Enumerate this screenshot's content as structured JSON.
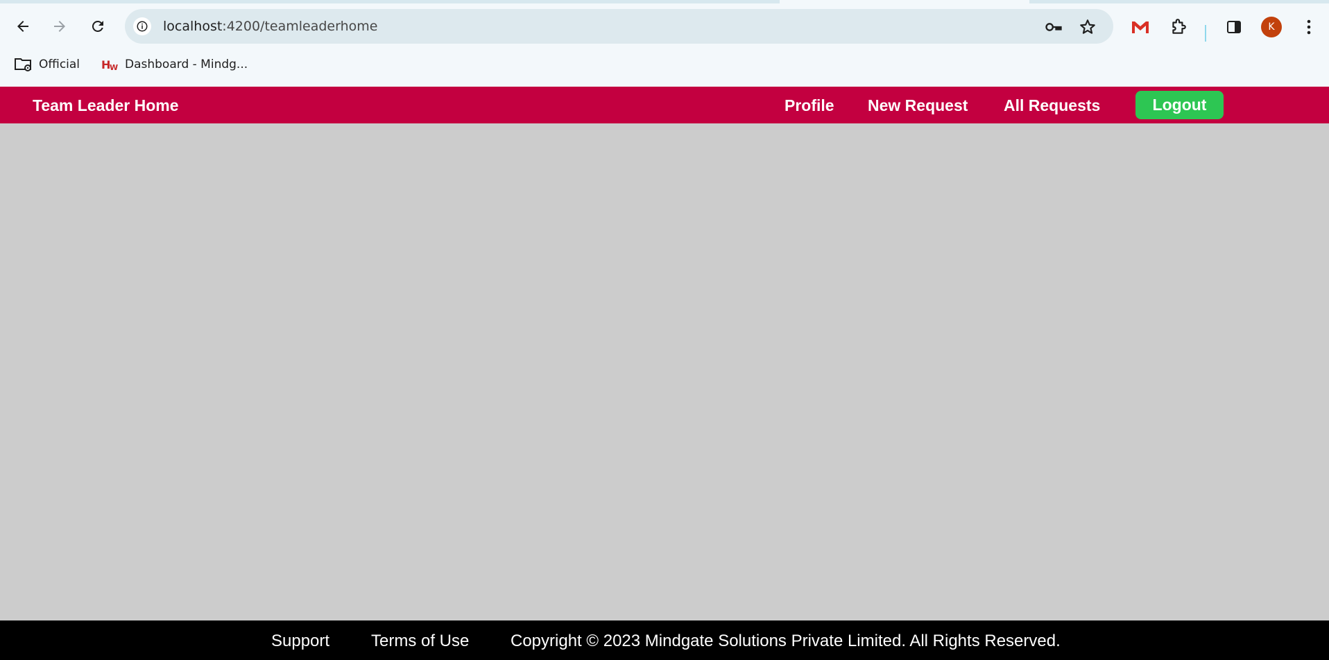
{
  "browser": {
    "url_host": "localhost",
    "url_path": ":4200/teamleaderhome",
    "bookmarks": [
      {
        "label": "Official",
        "icon": "folder-settings-icon"
      },
      {
        "label": "Dashboard - Mindg...",
        "icon": "hw-site-icon"
      }
    ],
    "profile_initial": "K",
    "colors": {
      "chrome_bg": "#f3f8fb",
      "omnibox_bg": "#dde9ee",
      "avatar": "#c2410c"
    }
  },
  "header": {
    "brand": "Team Leader Home",
    "nav": [
      {
        "label": "Profile"
      },
      {
        "label": "New Request"
      },
      {
        "label": "All Requests"
      }
    ],
    "logout_label": "Logout",
    "colors": {
      "bar": "#c30040",
      "logout": "#2dc653"
    }
  },
  "footer": {
    "support": "Support",
    "terms": "Terms of Use",
    "copyright": "Copyright © 2023 Mindgate Solutions Private Limited. All Rights Reserved."
  }
}
